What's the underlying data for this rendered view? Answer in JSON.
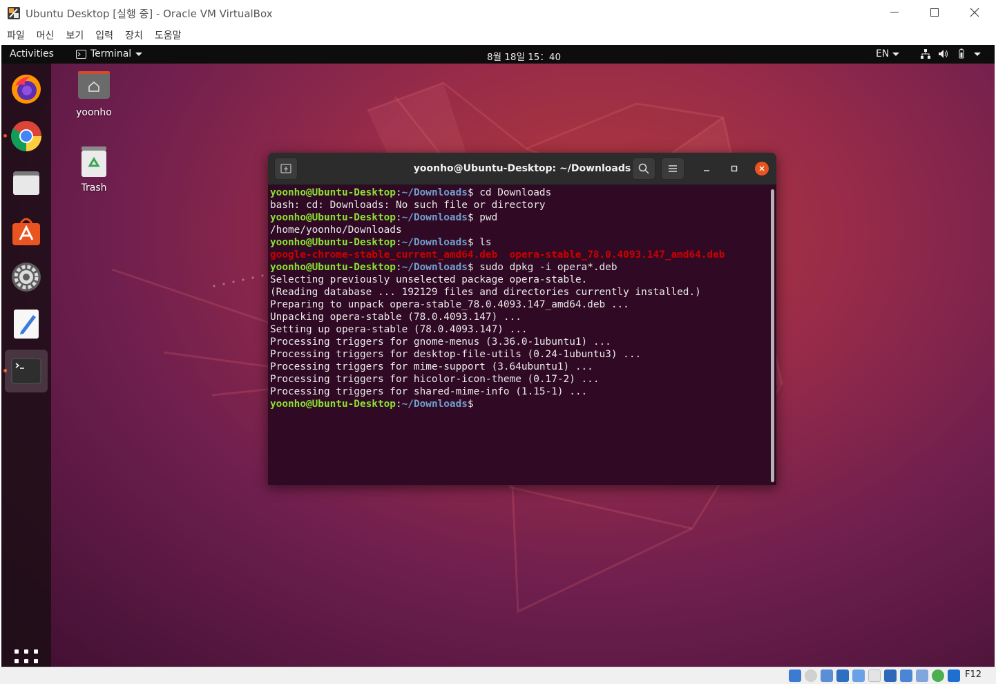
{
  "host_window": {
    "title": "Ubuntu Desktop [실행 중] - Oracle VM VirtualBox",
    "menu": [
      "파일",
      "머신",
      "보기",
      "입력",
      "장치",
      "도움말"
    ]
  },
  "topbar": {
    "activities": "Activities",
    "app_menu": "Terminal",
    "clock": "8월 18일  15：40",
    "input_language": "EN"
  },
  "dock": {
    "items": [
      {
        "name": "firefox",
        "running": false
      },
      {
        "name": "chrome",
        "running": true
      },
      {
        "name": "files",
        "running": false
      },
      {
        "name": "software",
        "running": false
      },
      {
        "name": "settings",
        "running": false
      },
      {
        "name": "text-editor",
        "running": false
      },
      {
        "name": "terminal",
        "running": true,
        "active": true
      }
    ]
  },
  "desktop": {
    "icons": [
      {
        "label": "yoonho",
        "icon": "home-folder-icon"
      },
      {
        "label": "Trash",
        "icon": "trash-icon"
      }
    ]
  },
  "terminal": {
    "title": "yoonho@Ubuntu-Desktop: ~/Downloads",
    "prompt_user": "yoonho@Ubuntu-Desktop",
    "prompt_path": "~/Downloads",
    "lines": [
      {
        "type": "cmd",
        "text": "cd Downloads"
      },
      {
        "type": "out",
        "text": "bash: cd: Downloads: No such file or directory"
      },
      {
        "type": "cmd",
        "text": "pwd"
      },
      {
        "type": "out",
        "text": "/home/yoonho/Downloads"
      },
      {
        "type": "cmd",
        "text": "ls"
      },
      {
        "type": "files",
        "files": [
          "google-chrome-stable_current_amd64.deb",
          "opera-stable_78.0.4093.147_amd64.deb"
        ]
      },
      {
        "type": "cmd",
        "text": "sudo dpkg -i opera*.deb"
      },
      {
        "type": "out",
        "text": "Selecting previously unselected package opera-stable."
      },
      {
        "type": "out",
        "text": "(Reading database ... 192129 files and directories currently installed.)"
      },
      {
        "type": "out",
        "text": "Preparing to unpack opera-stable_78.0.4093.147_amd64.deb ..."
      },
      {
        "type": "out",
        "text": "Unpacking opera-stable (78.0.4093.147) ..."
      },
      {
        "type": "out",
        "text": "Setting up opera-stable (78.0.4093.147) ..."
      },
      {
        "type": "out",
        "text": "Processing triggers for gnome-menus (3.36.0-1ubuntu1) ..."
      },
      {
        "type": "out",
        "text": "Processing triggers for desktop-file-utils (0.24-1ubuntu3) ..."
      },
      {
        "type": "out",
        "text": "Processing triggers for mime-support (3.64ubuntu1) ..."
      },
      {
        "type": "out",
        "text": "Processing triggers for hicolor-icon-theme (0.17-2) ..."
      },
      {
        "type": "out",
        "text": "Processing triggers for shared-mime-info (1.15-1) ..."
      },
      {
        "type": "cmd",
        "text": ""
      }
    ]
  },
  "statusbar": {
    "host_key": "F12"
  },
  "colors": {
    "ubuntu_orange": "#e95420",
    "terminal_bg": "#300a24",
    "prompt_green": "#8ae234",
    "prompt_blue": "#729fcf",
    "deb_red": "#cc0000"
  }
}
